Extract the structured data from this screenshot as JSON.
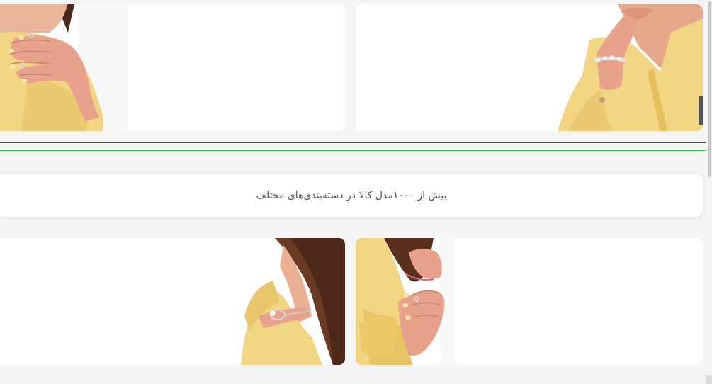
{
  "colors": {
    "page_background": "#f4f4f4",
    "card_background": "#ffffff",
    "divider_pink": "#c2185b",
    "divider_green": "#3fbf3f",
    "text": "#555555",
    "garment_yellow": "#f1d582",
    "skin": "#e8a28b",
    "hair": "#6a3a25"
  },
  "banners": {
    "top_left": {
      "image": "woman-hand-ring-photo"
    },
    "top_right": {
      "image": "woman-floral-bracelet-photo"
    },
    "bottom_left": {
      "image": "woman-knot-bracelet-photo"
    },
    "bottom_right": {
      "image": "woman-hand-ring-hair-photo"
    }
  },
  "info": {
    "text": "بیش از ۱۰۰۰مدل کالا در دسته‌بندی‌های مختلف"
  }
}
